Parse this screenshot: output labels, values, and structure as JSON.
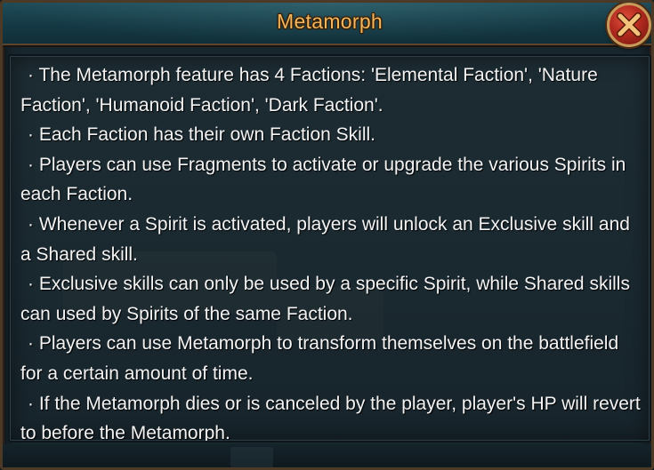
{
  "dialog": {
    "title": "Metamorph",
    "close_icon": "close-icon",
    "colors": {
      "title": "#f1b760",
      "text": "#f3f3f3",
      "panel": "#1a2830",
      "close": "#b22a1e"
    },
    "paragraphs": [
      "· The Metamorph feature has 4 Factions: 'Elemental Faction', 'Nature Faction', 'Humanoid Faction', 'Dark Faction'.",
      "· Each Faction has their own Faction Skill.",
      "· Players can use Fragments to activate or upgrade the various Spirits in each Faction.",
      "· Whenever a Spirit is activated, players will unlock an Exclusive skill and a Shared skill.",
      "· Exclusive skills can only be used by a specific Spirit, while Shared skills can used by Spirits of the same Faction.",
      "· Players can use Metamorph to transform themselves on the battlefield for a certain amount of time.",
      "· If the Metamorph dies or is canceled by the player, player's HP will revert to before the Metamorph."
    ]
  }
}
